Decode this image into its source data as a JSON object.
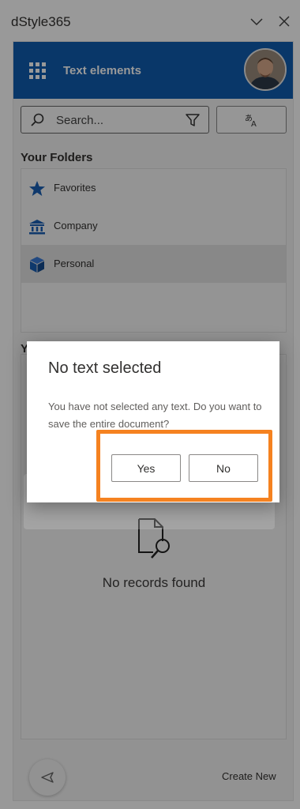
{
  "pane": {
    "title": "dStyle365",
    "chevron_icon": "chevron-down-icon",
    "close_icon": "close-icon"
  },
  "app": {
    "title": "Text elements",
    "header_color": "#0f5cb0",
    "search": {
      "placeholder": "Search...",
      "value": ""
    },
    "folders_heading": "Your Folders",
    "folders": [
      {
        "label": "Favorites",
        "icon": "star-icon"
      },
      {
        "label": "Company",
        "icon": "bank-icon"
      },
      {
        "label": "Personal",
        "icon": "cube-icon",
        "selected": true
      }
    ],
    "records_heading_partial": "Y",
    "empty_state": "No records found",
    "create_new": "Create New"
  },
  "dialog": {
    "title": "No text selected",
    "message": "You have not selected any text. Do you want to save the entire document?",
    "yes_label": "Yes",
    "no_label": "No"
  },
  "highlight_color": "#f58220"
}
